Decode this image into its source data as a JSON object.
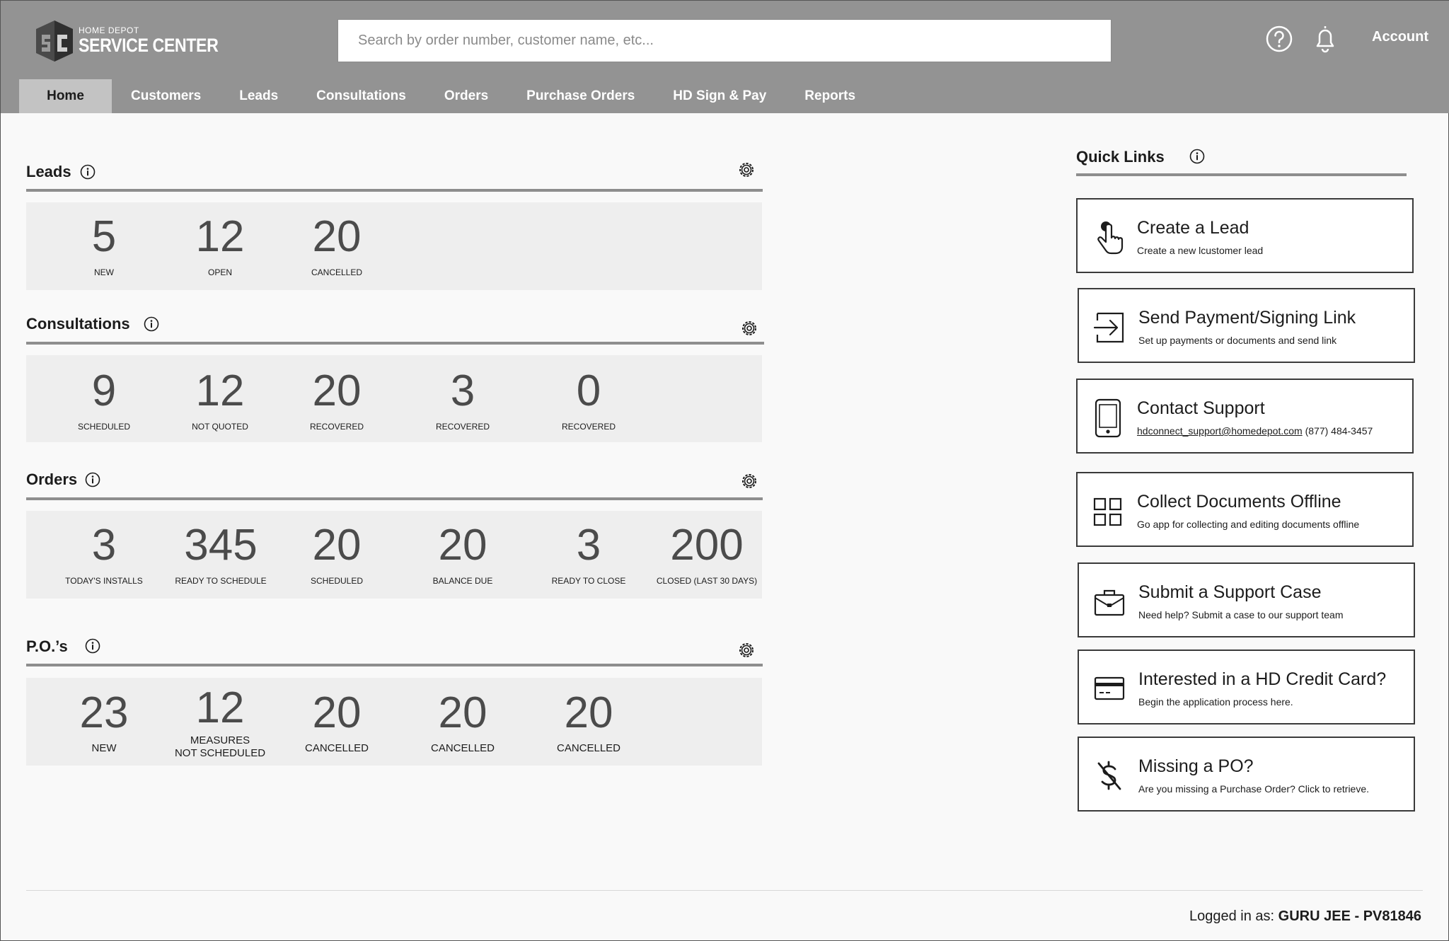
{
  "brand": {
    "top": "HOME DEPOT",
    "main": "SERVICE CENTER"
  },
  "search": {
    "placeholder": "Search by order number, customer name, etc..."
  },
  "account": {
    "label": "Account"
  },
  "nav": [
    "Home",
    "Customers",
    "Leads",
    "Consultations",
    "Orders",
    "Purchase Orders",
    "HD Sign & Pay",
    "Reports"
  ],
  "leads": {
    "title": "Leads",
    "stats": [
      {
        "value": "5",
        "label": "NEW"
      },
      {
        "value": "12",
        "label": "OPEN"
      },
      {
        "value": "20",
        "label": "CANCELLED"
      }
    ]
  },
  "consultations": {
    "title": "Consultations",
    "stats": [
      {
        "value": "9",
        "label": "SCHEDULED"
      },
      {
        "value": "12",
        "label": "NOT QUOTED"
      },
      {
        "value": "20",
        "label": "RECOVERED"
      },
      {
        "value": "3",
        "label": "RECOVERED"
      },
      {
        "value": "0",
        "label": "RECOVERED"
      }
    ]
  },
  "orders": {
    "title": "Orders",
    "stats": [
      {
        "value": "3",
        "label": "TODAY'S INSTALLS"
      },
      {
        "value": "345",
        "label": "READY TO SCHEDULE"
      },
      {
        "value": "20",
        "label": "SCHEDULED"
      },
      {
        "value": "20",
        "label": "BALANCE DUE"
      },
      {
        "value": "3",
        "label": "READY TO CLOSE"
      },
      {
        "value": "200",
        "label": "CLOSED (LAST 30 DAYS)"
      }
    ]
  },
  "pos": {
    "title": "P.O.’s",
    "stats": [
      {
        "value": "23",
        "label": "NEW"
      },
      {
        "value": "12",
        "label": "MEASURES",
        "label2": "NOT SCHEDULED"
      },
      {
        "value": "20",
        "label": "CANCELLED"
      },
      {
        "value": "20",
        "label": "CANCELLED"
      },
      {
        "value": "20",
        "label": "CANCELLED"
      }
    ]
  },
  "quick_links": {
    "title": "Quick Links",
    "items": [
      {
        "icon": "hand-pointer-icon",
        "title": "Create a Lead",
        "desc": "Create a new lcustomer lead"
      },
      {
        "icon": "send-arrow-icon",
        "title": "Send Payment/Signing Link",
        "desc": "Set up payments or documents and send link"
      },
      {
        "icon": "tablet-icon",
        "title": "Contact Support",
        "email": "hdconnect_support@homedepot.com",
        "phone": "(877) 484-3457"
      },
      {
        "icon": "grid-icon",
        "title": "Collect Documents Offline",
        "desc": "Go  app for collecting and editing documents offline"
      },
      {
        "icon": "briefcase-icon",
        "title": "Submit a Support Case",
        "desc": "Need help? Submit a case to our support team"
      },
      {
        "icon": "credit-card-icon",
        "title": "Interested in a HD Credit Card?",
        "desc": "Begin the application process here."
      },
      {
        "icon": "no-dollar-icon",
        "title": "Missing a PO?",
        "desc": "Are you missing a Purchase Order? Click to retrieve."
      }
    ]
  },
  "footer": {
    "prefix": "Logged in as:",
    "user": "GURU JEE - PV81846"
  }
}
